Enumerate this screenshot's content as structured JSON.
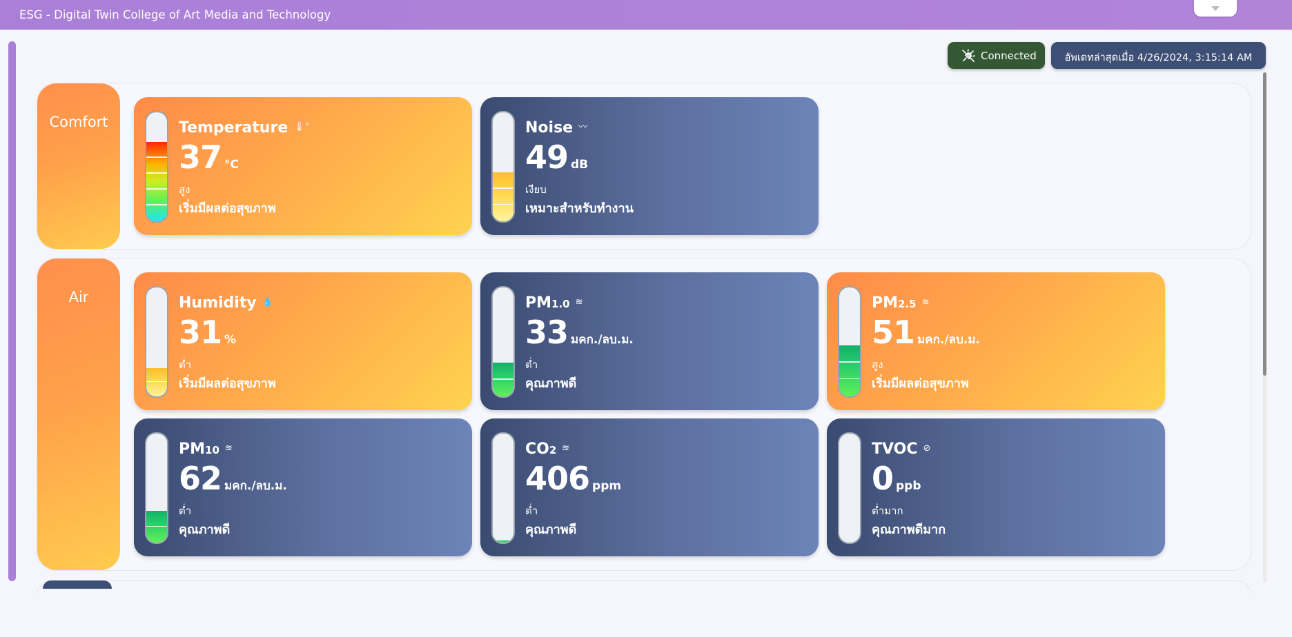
{
  "window": {
    "title": "ESG - Digital Twin College of Art Media and Technology"
  },
  "status": {
    "connection_label": "Connected",
    "connection_color": "#355834",
    "last_updated": "อัพเดทล่าสุดเมื่อ 4/26/2024, 3:15:14 AM"
  },
  "colors": {
    "accent_purple": "#a97fd8",
    "warm_card_start": "#ff8b48",
    "warm_card_end": "#ffd34f",
    "cool_card_start": "#3a4b71",
    "cool_card_end": "#6c84b8"
  },
  "sections": {
    "comfort": {
      "label": "Comfort"
    },
    "air": {
      "label": "Air"
    }
  },
  "sensors": {
    "temperature": {
      "name": "Temperature",
      "icon": "thermometer-icon",
      "value": "37",
      "unit": "°C",
      "level": "สูง",
      "description": "เริ่มมีผลต่อสุขภาพ",
      "gauge_fraction": 0.73,
      "gauge_style": "rainbow"
    },
    "noise": {
      "name": "Noise",
      "icon": "sound-wave-icon",
      "value": "49",
      "unit": "dB",
      "level": "เงียบ",
      "description": "เหมาะสำหรับทำงาน",
      "gauge_fraction": 0.45,
      "gauge_style": "yellow"
    },
    "humidity": {
      "name": "Humidity",
      "icon": "droplet-icon",
      "value": "31",
      "unit": "%",
      "level": "ต่ำ",
      "description": "เริ่มมีผลต่อสุขภาพ",
      "gauge_fraction": 0.26,
      "gauge_style": "yellow"
    },
    "pm1": {
      "name": "PM",
      "name_sub": "1.0",
      "icon": "haze-icon",
      "value": "33",
      "unit": "มคก./ลบ.ม.",
      "level": "ต่ำ",
      "description": "คุณภาพดี",
      "gauge_fraction": 0.31,
      "gauge_style": "green"
    },
    "pm25": {
      "name": "PM",
      "name_sub": "2.5",
      "icon": "haze-icon",
      "value": "51",
      "unit": "มคก./ลบ.ม.",
      "level": "สูง",
      "description": "เริ่มมีผลต่อสุขภาพ",
      "gauge_fraction": 0.47,
      "gauge_style": "green"
    },
    "pm10": {
      "name": "PM",
      "name_sub": "10",
      "icon": "haze-icon",
      "value": "62",
      "unit": "มคก./ลบ.ม.",
      "level": "ต่ำ",
      "description": "คุณภาพดี",
      "gauge_fraction": 0.29,
      "gauge_style": "green"
    },
    "co2": {
      "name": "CO",
      "name_sub": "2",
      "icon": "haze-icon",
      "value": "406",
      "unit": "ppm",
      "level": "ต่ำ",
      "description": "คุณภาพดี",
      "gauge_fraction": 0.02,
      "gauge_style": "green"
    },
    "tvoc": {
      "name": "TVOC",
      "icon": "no-virus-icon",
      "value": "0",
      "unit": "ppb",
      "level": "ต่ำมาก",
      "description": "คุณภาพดีมาก",
      "gauge_fraction": 0,
      "gauge_style": "green"
    }
  }
}
